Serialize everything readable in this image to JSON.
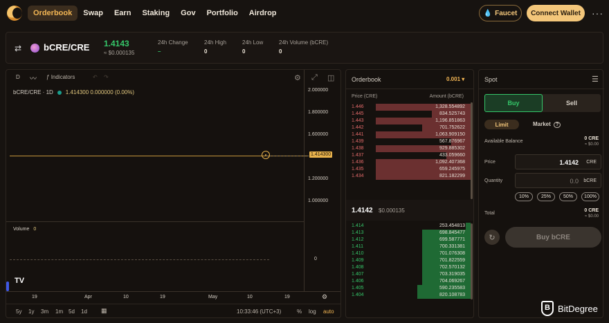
{
  "nav": {
    "items": [
      "Orderbook",
      "Swap",
      "Earn",
      "Staking",
      "Gov",
      "Portfolio",
      "Airdrop"
    ],
    "faucet": "Faucet",
    "connect": "Connect Wallet",
    "more": "···"
  },
  "pair": {
    "name": "bCRE/CRE",
    "price": "1.4143",
    "price_usd": "≈ $0.000135",
    "stats": [
      {
        "label": "24h Change",
        "value": "–"
      },
      {
        "label": "24h High",
        "value": "0"
      },
      {
        "label": "24h Low",
        "value": "0"
      },
      {
        "label": "24h Volume (bCRE)",
        "value": "0"
      }
    ]
  },
  "chart": {
    "toolbar": {
      "d": "D",
      "indicators": "Indicators"
    },
    "legend": {
      "symbol": "bCRE/CRE · 1D",
      "values": "1.414300  0.000000 (0.00%)"
    },
    "y_ticks": [
      "2.000000",
      "1.800000",
      "1.600000",
      "1.414300",
      "1.200000",
      "1.000000"
    ],
    "price_tag": "1.414300",
    "volume_label": "Volume",
    "volume_value": "0",
    "volume_axis": "0",
    "x_ticks": [
      "19",
      "Apr",
      "10",
      "19",
      "May",
      "10",
      "19"
    ],
    "ranges": [
      "5y",
      "1y",
      "3m",
      "1m",
      "5d",
      "1d"
    ],
    "time": "10:33:46 (UTC+3)",
    "scale": {
      "pct": "%",
      "log": "log",
      "auto": "auto"
    }
  },
  "orderbook": {
    "title": "Orderbook",
    "tick": "0.001",
    "header_price": "Price (CRE)",
    "header_amount": "Amount (bCRE)",
    "asks": [
      {
        "p": "1.446",
        "a": "1,328.554892",
        "w": 0.98
      },
      {
        "p": "1.445",
        "a": "834.525743",
        "w": 0.4
      },
      {
        "p": "1.443",
        "a": "1,196.851863",
        "w": 0.98
      },
      {
        "p": "1.442",
        "a": "701.752622",
        "w": 0.5
      },
      {
        "p": "1.441",
        "a": "1,063.909150",
        "w": 0.98
      },
      {
        "p": "1.439",
        "a": "567.876967",
        "w": 0.2
      },
      {
        "p": "1.438",
        "a": "929.885302",
        "w": 0.98
      },
      {
        "p": "1.437",
        "a": "433.059660",
        "w": 0.25
      },
      {
        "p": "1.436",
        "a": "1,092.407368",
        "w": 0.98
      },
      {
        "p": "1.435",
        "a": "659.245975",
        "w": 0.98
      },
      {
        "p": "1.434",
        "a": "821.182299",
        "w": 0.98
      }
    ],
    "mid_price": "1.4142",
    "mid_usd": "$0.000135",
    "bids": [
      {
        "p": "1.414",
        "a": "253.454813",
        "w": 0.05
      },
      {
        "p": "1.413",
        "a": "698.845477",
        "w": 0.5
      },
      {
        "p": "1.412",
        "a": "699.587771",
        "w": 0.5
      },
      {
        "p": "1.411",
        "a": "700.331381",
        "w": 0.5
      },
      {
        "p": "1.410",
        "a": "701.076308",
        "w": 0.5
      },
      {
        "p": "1.409",
        "a": "701.822559",
        "w": 0.5
      },
      {
        "p": "1.408",
        "a": "702.570132",
        "w": 0.5
      },
      {
        "p": "1.407",
        "a": "703.319035",
        "w": 0.5
      },
      {
        "p": "1.406",
        "a": "704.069267",
        "w": 0.5
      },
      {
        "p": "1.405",
        "a": "590.235583",
        "w": 0.55
      },
      {
        "p": "1.404",
        "a": "820.108783",
        "w": 0.55
      }
    ]
  },
  "spot": {
    "title": "Spot",
    "buy": "Buy",
    "sell": "Sell",
    "limit": "Limit",
    "market": "Market",
    "available_label": "Available Balance",
    "available_value": "0 CRE",
    "available_usd": "≈ $0.00",
    "price_label": "Price",
    "price_value": "1.4142",
    "price_unit": "CRE",
    "qty_label": "Quantity",
    "qty_value": "0.0",
    "qty_unit": "bCRE",
    "pcts": [
      "10%",
      "25%",
      "50%",
      "100%"
    ],
    "total_label": "Total",
    "total_value": "0 CRE",
    "total_usd": "≈ $0.00",
    "buy_button": "Buy bCRE"
  },
  "watermark": "BitDegree",
  "colors": {
    "accent": "#f3b654",
    "green": "#35c76a",
    "red": "#e56b6b"
  }
}
